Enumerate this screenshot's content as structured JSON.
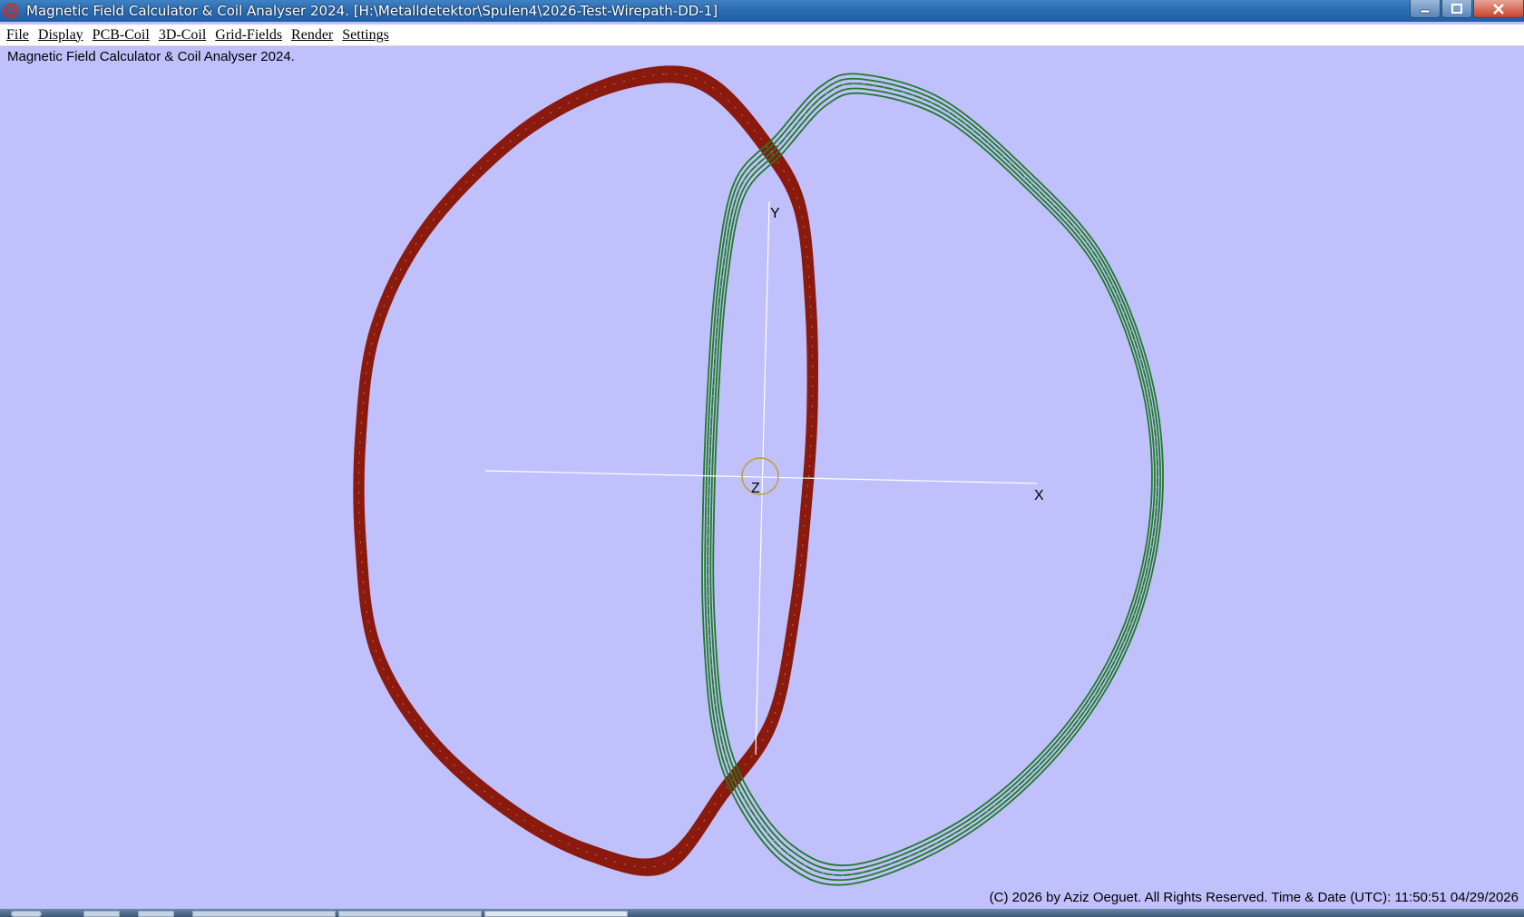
{
  "window": {
    "title": "Magnetic Field Calculator & Coil Analyser 2024.  [H:\\Metalldetektor\\Spulen4\\2026-Test-Wirepath-DD-1]"
  },
  "menu": [
    {
      "label": "File"
    },
    {
      "label": "Display"
    },
    {
      "label": "PCB-Coil"
    },
    {
      "label": "3D-Coil"
    },
    {
      "label": "Grid-Fields"
    },
    {
      "label": "Render"
    },
    {
      "label": "Settings"
    }
  ],
  "viewport": {
    "caption": "Magnetic Field Calculator & Coil Analyser 2024.",
    "axes": {
      "x": "X",
      "y": "Y",
      "z": "Z"
    },
    "colors": {
      "background": "#c0c0fc",
      "coil_tx": "#8b1a0e",
      "coil_rx": "#1e7a26",
      "axes": "#ffffff",
      "origin_marker": "#b8a030"
    },
    "coils": [
      {
        "name_icon": "coil-d-left",
        "color": "#8b1a0e"
      },
      {
        "name_icon": "coil-d-right",
        "color": "#1e7a26"
      }
    ]
  },
  "footer": {
    "copyright": "(C) 2026  by Aziz Oeguet. All Rights Reserved.  Time & Date (UTC): 11:50:51  04/29/2026"
  },
  "window_controls": {
    "minimize_icon": "minimize-icon",
    "maximize_icon": "maximize-icon",
    "close_icon": "close-icon"
  }
}
